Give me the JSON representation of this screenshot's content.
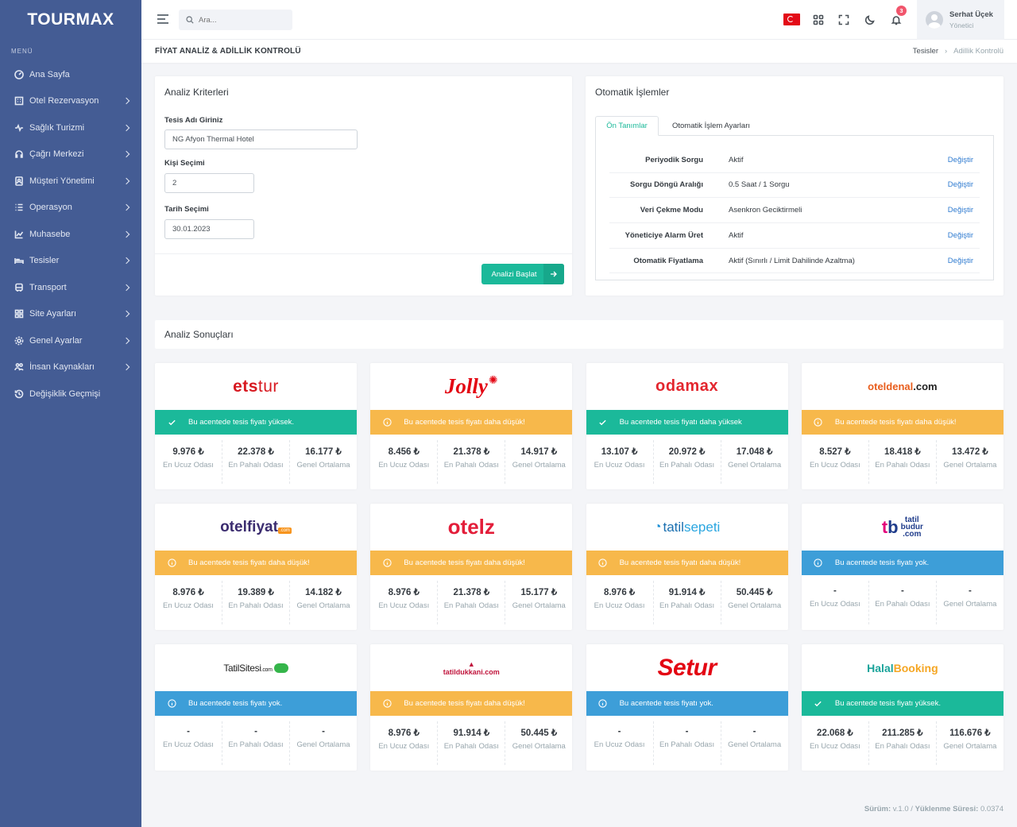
{
  "app": {
    "logo": "TOURMAX"
  },
  "sidebar": {
    "menu_label": "MENÜ",
    "items": [
      {
        "label": "Ana Sayfa",
        "icon": "dashboard-icon",
        "has_children": false
      },
      {
        "label": "Otel Rezervasyon",
        "icon": "building-icon",
        "has_children": true
      },
      {
        "label": "Sağlık Turizmi",
        "icon": "heartbeat-icon",
        "has_children": true
      },
      {
        "label": "Çağrı Merkezi",
        "icon": "headset-icon",
        "has_children": true
      },
      {
        "label": "Müşteri Yönetimi",
        "icon": "contact-book-icon",
        "has_children": true
      },
      {
        "label": "Operasyon",
        "icon": "list-icon",
        "has_children": true
      },
      {
        "label": "Muhasebe",
        "icon": "chart-line-icon",
        "has_children": true
      },
      {
        "label": "Tesisler",
        "icon": "bed-icon",
        "has_children": true
      },
      {
        "label": "Transport",
        "icon": "bus-icon",
        "has_children": true
      },
      {
        "label": "Site Ayarları",
        "icon": "grid-icon",
        "has_children": true
      },
      {
        "label": "Genel Ayarlar",
        "icon": "gear-icon",
        "has_children": true
      },
      {
        "label": "İnsan Kaynakları",
        "icon": "people-icon",
        "has_children": true
      },
      {
        "label": "Değişiklik Geçmişi",
        "icon": "history-icon",
        "has_children": false
      }
    ]
  },
  "topbar": {
    "search_placeholder": "Ara...",
    "notification_count": "3",
    "user_name": "Serhat Üçek",
    "user_role": "Yönetici"
  },
  "page": {
    "title": "FİYAT ANALİZ & ADİLLİK KONTROLÜ",
    "breadcrumb": [
      "Tesisler",
      "Adillik Kontrolü"
    ]
  },
  "criteria": {
    "title": "Analiz Kriterleri",
    "hotel_label": "Tesis Adı Giriniz",
    "hotel_value": "NG Afyon Thermal Hotel",
    "person_label": "Kişi Seçimi",
    "person_value": "2",
    "date_label": "Tarih Seçimi",
    "date_value": "30.01.2023",
    "submit_label": "Analizi Başlat"
  },
  "automation": {
    "title": "Otomatik İşlemler",
    "tabs": [
      "Ön Tanımlar",
      "Otomatik İşlem Ayarları"
    ],
    "change_label": "Değiştir",
    "rows": [
      {
        "key": "Periyodik Sorgu",
        "value": "Aktif"
      },
      {
        "key": "Sorgu Döngü Aralığı",
        "value": "0.5 Saat / 1 Sorgu"
      },
      {
        "key": "Veri Çekme Modu",
        "value": "Asenkron Geciktirmeli"
      },
      {
        "key": "Yöneticiye Alarm Üret",
        "value": "Aktif"
      },
      {
        "key": "Otomatik Fiyatlama",
        "value": "Aktif (Sınırlı / Limit Dahilinde Azaltma)"
      }
    ]
  },
  "results": {
    "title": "Analiz Sonuçları",
    "stat_labels": {
      "min": "En Ucuz Odası",
      "max": "En Pahalı Odası",
      "avg": "Genel Ortalama"
    },
    "colors": {
      "green": "#1bb99a",
      "orange": "#f7b84b",
      "blue": "#3d9ed8"
    },
    "agencies": [
      {
        "logo": "etstur",
        "status": "green",
        "message": "Bu acentede tesis fiyatı yüksek.",
        "min": "9.976 ₺",
        "max": "22.378 ₺",
        "avg": "16.177 ₺"
      },
      {
        "logo": "Jolly",
        "status": "orange",
        "message": "Bu acentede tesis fiyatı daha düşük!",
        "min": "8.456 ₺",
        "max": "21.378 ₺",
        "avg": "14.917 ₺"
      },
      {
        "logo": "odamax",
        "status": "green",
        "message": "Bu acentede tesis fiyatı daha yüksek",
        "min": "13.107 ₺",
        "max": "20.972 ₺",
        "avg": "17.048 ₺"
      },
      {
        "logo": "oteldenal.com",
        "status": "orange",
        "message": "Bu acentede tesis fiyatı daha düşük!",
        "min": "8.527 ₺",
        "max": "18.418 ₺",
        "avg": "13.472 ₺"
      },
      {
        "logo": "otelfiyat",
        "status": "orange",
        "message": "Bu acentede tesis fiyatı daha düşük!",
        "min": "8.976 ₺",
        "max": "19.389 ₺",
        "avg": "14.182 ₺"
      },
      {
        "logo": "otelz",
        "status": "orange",
        "message": "Bu acentede tesis fiyatı daha düşük!",
        "min": "8.976 ₺",
        "max": "21.378 ₺",
        "avg": "15.177 ₺"
      },
      {
        "logo": "tatilsepeti",
        "status": "orange",
        "message": "Bu acentede tesis fiyatı daha düşük!",
        "min": "8.976 ₺",
        "max": "91.914 ₺",
        "avg": "50.445 ₺"
      },
      {
        "logo": "tatilbudur.com",
        "status": "blue",
        "message": "Bu acentede tesis fiyatı yok.",
        "min": "-",
        "max": "-",
        "avg": "-"
      },
      {
        "logo": "TatilSitesi.com",
        "status": "blue",
        "message": "Bu acentede tesis fiyatı yok.",
        "min": "-",
        "max": "-",
        "avg": "-"
      },
      {
        "logo": "tatildukkani.com",
        "status": "orange",
        "message": "Bu acentede tesis fiyatı daha düşük!",
        "min": "8.976 ₺",
        "max": "91.914 ₺",
        "avg": "50.445 ₺"
      },
      {
        "logo": "Setur",
        "status": "blue",
        "message": "Bu acentede tesis fiyatı yok.",
        "min": "-",
        "max": "-",
        "avg": "-"
      },
      {
        "logo": "HalalBooking",
        "status": "green",
        "message": "Bu acentede tesis fiyatı yüksek.",
        "min": "22.068 ₺",
        "max": "211.285 ₺",
        "avg": "116.676 ₺"
      }
    ]
  },
  "footer": {
    "version_label": "Sürüm:",
    "version": "v.1.0",
    "load_label": "Yüklenme Süresi:",
    "load_time": "0.0374"
  }
}
